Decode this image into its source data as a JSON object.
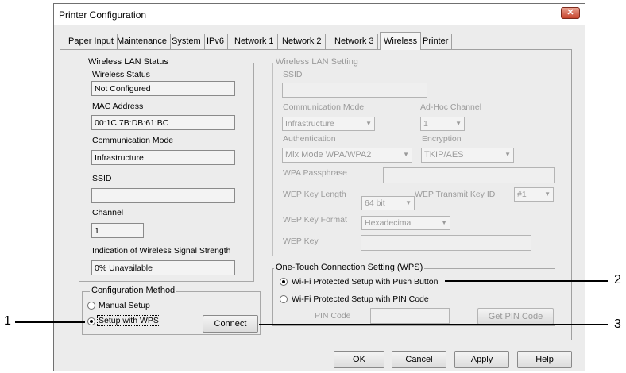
{
  "window": {
    "title": "Printer Configuration",
    "close_icon": "close-icon"
  },
  "tabs": [
    {
      "label": "Paper Input",
      "active": false
    },
    {
      "label": "Maintenance",
      "active": false
    },
    {
      "label": "System",
      "active": false
    },
    {
      "label": "IPv6",
      "active": false
    },
    {
      "label": "Network 1",
      "active": false
    },
    {
      "label": "Network 2",
      "active": false
    },
    {
      "label": "Network 3",
      "active": false
    },
    {
      "label": "Wireless",
      "active": true
    },
    {
      "label": "Printer",
      "active": false
    }
  ],
  "wireless_status": {
    "group_title": "Wireless LAN Status",
    "wireless_status_label": "Wireless Status",
    "wireless_status_value": "Not Configured",
    "mac_label": "MAC Address",
    "mac_value": "00:1C:7B:DB:61:BC",
    "comm_mode_label": "Communication Mode",
    "comm_mode_value": "Infrastructure",
    "ssid_label": "SSID",
    "ssid_value": "",
    "channel_label": "Channel",
    "channel_value": "1",
    "signal_label": "Indication of Wireless Signal Strength",
    "signal_value": "0% Unavailable"
  },
  "config_method": {
    "group_title": "Configuration Method",
    "manual_label": "Manual Setup",
    "wps_label": "Setup with WPS",
    "selected": "wps",
    "connect_label": "Connect"
  },
  "wireless_setting": {
    "group_title": "Wireless LAN Setting",
    "ssid_label": "SSID",
    "ssid_value": "",
    "comm_mode_label": "Communication Mode",
    "comm_mode_value": "Infrastructure",
    "adhoc_channel_label": "Ad-Hoc Channel",
    "adhoc_channel_value": "1",
    "auth_label": "Authentication",
    "auth_value": "Mix Mode WPA/WPA2",
    "encryption_label": "Encryption",
    "encryption_value": "TKIP/AES",
    "wpa_label": "WPA Passphrase",
    "wpa_value": "",
    "wep_length_label": "WEP Key Length",
    "wep_length_value": "64 bit",
    "wep_tx_label": "WEP Transmit Key ID",
    "wep_tx_value": "#1",
    "wep_format_label": "WEP Key Format",
    "wep_format_value": "Hexadecimal",
    "wep_key_label": "WEP Key",
    "wep_key_value": ""
  },
  "wps": {
    "group_title": "One-Touch Connection Setting (WPS)",
    "push_label": "Wi-Fi Protected Setup with Push Button",
    "pin_label": "Wi-Fi Protected Setup with PIN Code",
    "selected": "push",
    "pin_code_label": "PIN Code",
    "pin_code_value": "",
    "get_pin_label": "Get PIN Code"
  },
  "footer": {
    "ok_label": "OK",
    "cancel_label": "Cancel",
    "apply_label": "Apply",
    "help_label": "Help"
  },
  "callouts": {
    "one": "1",
    "two": "2",
    "three": "3"
  }
}
